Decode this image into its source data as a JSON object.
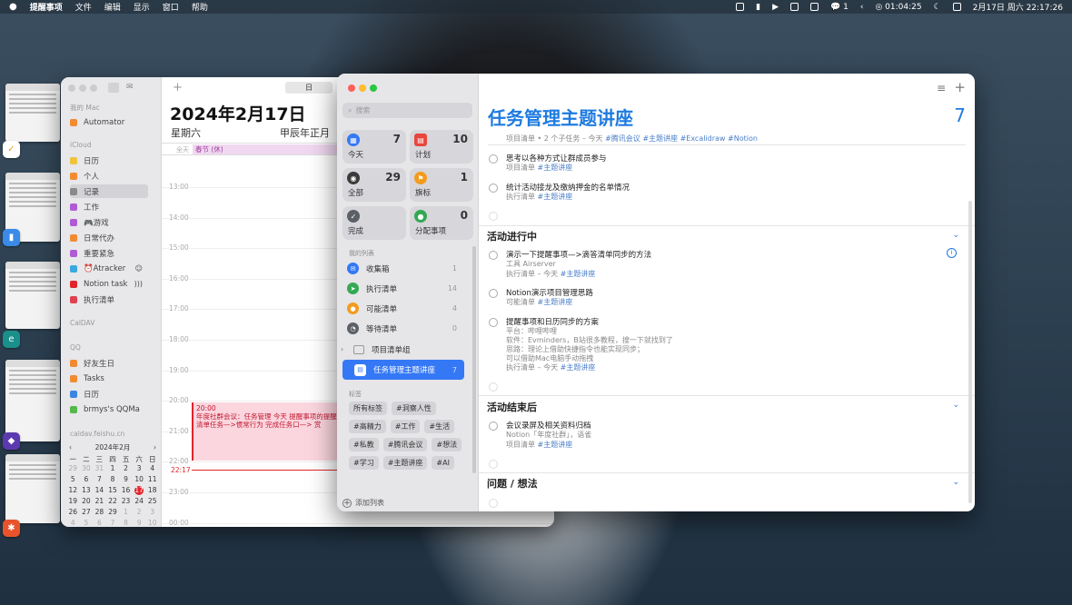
{
  "menubar": {
    "app": "提醒事项",
    "menus": [
      "文件",
      "编辑",
      "显示",
      "窗口",
      "帮助"
    ],
    "timer": "01:04:25",
    "wechat_count": "1",
    "datetime": "2月17日 周六 22:17:26"
  },
  "calendar": {
    "sidebar": {
      "section_mac": "我的 Mac",
      "mac_items": [
        {
          "label": "Automator",
          "color": "#f28b30"
        }
      ],
      "section_icloud": "iCloud",
      "icloud_items": [
        {
          "label": "日历",
          "color": "#f0c33c"
        },
        {
          "label": "个人",
          "color": "#f28b30"
        },
        {
          "label": "记录",
          "color": "#8a8a8a"
        },
        {
          "label": "工作",
          "color": "#b05ad6"
        },
        {
          "label": "🎮游戏",
          "color": "#b05ad6"
        },
        {
          "label": "日常代办",
          "color": "#f28b30"
        },
        {
          "label": "重要紧急",
          "color": "#b05ad6"
        },
        {
          "label": "⏰Atracker",
          "color": "#39a8e0"
        },
        {
          "label": "Notion task",
          "color": "#e0242c"
        },
        {
          "label": "执行清单",
          "color": "#e0404f"
        }
      ],
      "section_caldav": "CalDAV",
      "section_qq": "QQ",
      "qq_items": [
        {
          "label": "好友生日",
          "color": "#f28b30"
        },
        {
          "label": "Tasks",
          "color": "#f28b30"
        },
        {
          "label": "日历",
          "color": "#3a86e0"
        },
        {
          "label": "brmys's QQMa",
          "color": "#55b84a"
        }
      ],
      "section_feishu": "caldav.feishu.cn"
    },
    "mini_month": {
      "title": "2024年2月",
      "weekdays": [
        "一",
        "二",
        "三",
        "四",
        "五",
        "六",
        "日"
      ],
      "days": [
        "29",
        "30",
        "31",
        "1",
        "2",
        "3",
        "4",
        "5",
        "6",
        "7",
        "8",
        "9",
        "10",
        "11",
        "12",
        "13",
        "14",
        "15",
        "16",
        "17",
        "18",
        "19",
        "20",
        "21",
        "22",
        "23",
        "24",
        "25",
        "26",
        "27",
        "28",
        "29",
        "1",
        "2",
        "3",
        "4",
        "5",
        "6",
        "7",
        "8",
        "9",
        "10"
      ],
      "today": "17"
    },
    "tab_day": "日",
    "date_title": "2024年2月17日",
    "weekday": "星期六",
    "lunar": "甲辰年正月",
    "allday_label": "全天",
    "allday_event": "春节 (休)",
    "hours": [
      "13:00",
      "14:00",
      "15:00",
      "16:00",
      "17:00",
      "18:00",
      "19:00",
      "20:00",
      "21:00",
      "22:00",
      "23:00",
      "00:00"
    ],
    "now_time": "22:17",
    "event": {
      "time": "20:00",
      "text": "年度社群会议：任务管理 今天 提醒事项的提醒 > 触发器 清单任务—>惯常行为 完成任务口—> 赏"
    }
  },
  "reminders": {
    "search_placeholder": "搜索",
    "smart": [
      {
        "label": "今天",
        "count": "7",
        "color": "#3478f6",
        "glyph": "▦"
      },
      {
        "label": "计划",
        "count": "10",
        "color": "#e8453c",
        "glyph": "▤"
      },
      {
        "label": "全部",
        "count": "29",
        "color": "#3b3b3b",
        "glyph": "◉"
      },
      {
        "label": "旗标",
        "count": "1",
        "color": "#f29b1d",
        "glyph": "⚑"
      },
      {
        "label": "完成",
        "count": "",
        "color": "#5b6068",
        "glyph": "✓"
      },
      {
        "label": "分配事项",
        "count": "0",
        "color": "#34a853",
        "glyph": "●"
      }
    ],
    "section_lists": "我的列表",
    "lists": [
      {
        "label": "收集箱",
        "count": "1",
        "color": "#3478f6",
        "glyph": "✉"
      },
      {
        "label": "执行清单",
        "count": "14",
        "color": "#34a853",
        "glyph": "➤"
      },
      {
        "label": "可能清单",
        "count": "4",
        "color": "#f29b1d",
        "glyph": "●"
      },
      {
        "label": "等待清单",
        "count": "0",
        "color": "#5b6068",
        "glyph": "◔"
      }
    ],
    "group": "项目清单组",
    "selected_list": {
      "label": "任务管理主题讲座",
      "count": "7"
    },
    "section_tags": "标签",
    "tags": [
      "所有标签",
      "#洞察人性",
      "#高精力",
      "#工作",
      "#生活",
      "#私教",
      "#腾讯会议",
      "#想法",
      "#学习",
      "#主题讲座",
      "#AI"
    ],
    "add_list": "添加列表",
    "title": "任务管理主题讲座",
    "count": "7",
    "top_subline_prefix": "项目清单 • 2 个子任务 – 今天",
    "top_subline_tags": "#腾讯会议 #主题讲座 #Excalidraw #Notion",
    "tasks_a": [
      {
        "title": "思考以各种方式让群成员参与",
        "meta": "项目清单",
        "tag": "#主题讲座"
      },
      {
        "title": "统计活动接龙及缴纳押金的名单情况",
        "meta": "执行清单",
        "tag": "#主题讲座"
      }
    ],
    "section_active": "活动进行中",
    "task_b1": {
      "title": "演示一下提醒事项—>滴答清单同步的方法",
      "note": "工具 Airserver",
      "meta": "执行清单 – 今天",
      "tag": "#主题讲座"
    },
    "task_b2": {
      "title": "Notion演示项目管理思路",
      "meta": "可能清单",
      "tag": "#主题讲座"
    },
    "task_b3": {
      "title": "提醒事项和日历同步的方案",
      "notes": [
        "平台：哔哩哔哩",
        "软件：Evminders，B站很多教程，搜一下就找到了",
        "思路：理论上借助快捷指令也能实现同步；",
        "可以借助Mac电脑手动拖拽"
      ],
      "meta": "执行清单 – 今天",
      "tag": "#主题讲座"
    },
    "section_after": "活动结束后",
    "task_c1": {
      "title": "会议录屏及相关资料归档",
      "note": "Notion「年度社群」，语雀",
      "meta": "项目清单",
      "tag": "#主题讲座"
    },
    "section_questions": "问题 / 想法"
  }
}
